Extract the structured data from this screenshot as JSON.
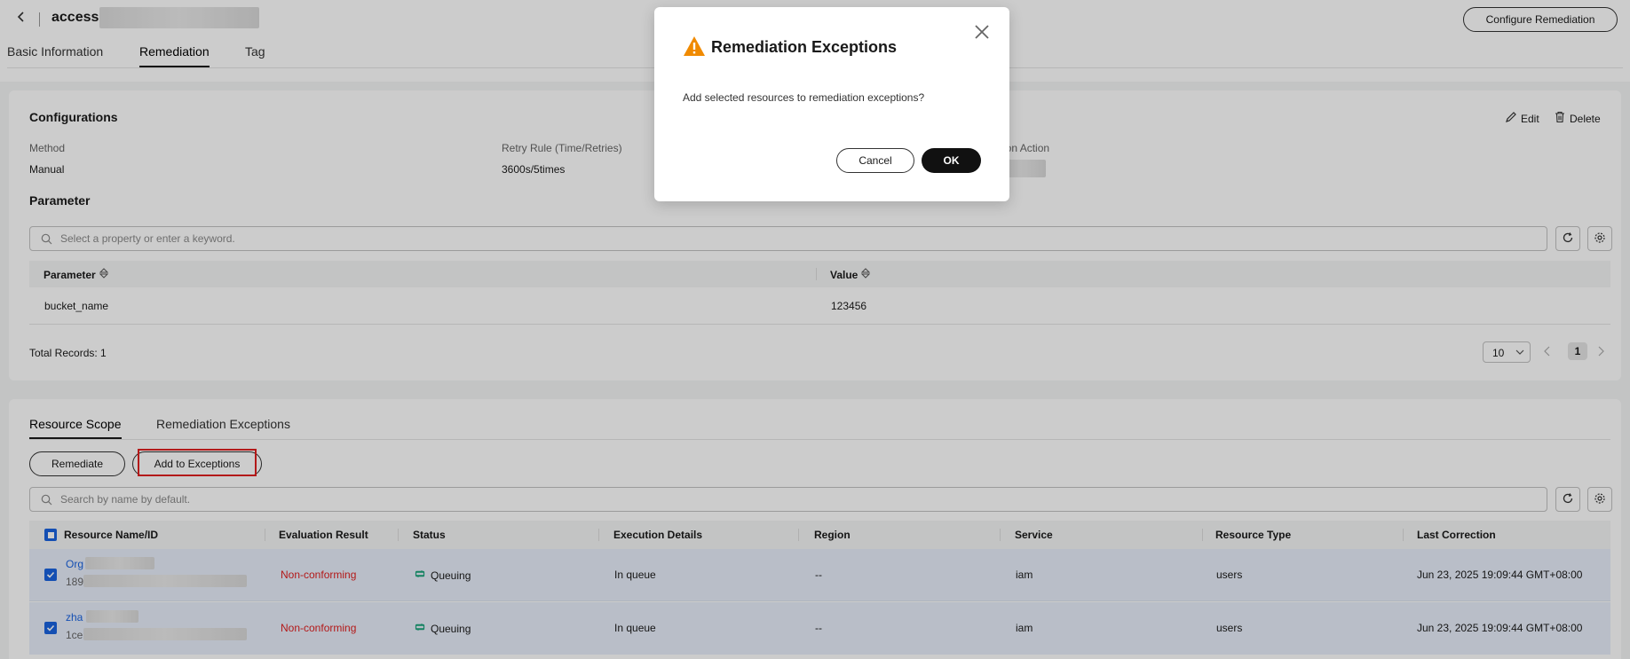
{
  "header": {
    "title": "access",
    "configure_label": "Configure Remediation",
    "tabs": [
      {
        "label": "Basic Information",
        "active": false
      },
      {
        "label": "Remediation",
        "active": true
      },
      {
        "label": "Tag",
        "active": false
      }
    ]
  },
  "config": {
    "title": "Configurations",
    "edit_label": "Edit",
    "delete_label": "Delete",
    "method_label": "Method",
    "method_value": "Manual",
    "retry_label": "Retry Rule (Time/Retries)",
    "retry_value": "3600s/5times",
    "action_label": "ation Action",
    "parameter_title": "Parameter",
    "search_placeholder": "Select a property or enter a keyword.",
    "table": {
      "columns": [
        "Parameter",
        "Value"
      ],
      "rows": [
        {
          "parameter": "bucket_name",
          "value": "123456"
        }
      ]
    },
    "total_records": "Total Records: 1",
    "page_size": "10",
    "current_page": "1"
  },
  "resource": {
    "tabs": [
      {
        "label": "Resource Scope",
        "active": true
      },
      {
        "label": "Remediation Exceptions",
        "active": false
      }
    ],
    "remediate_label": "Remediate",
    "add_exceptions_label": "Add to Exceptions",
    "search_placeholder": "Search by name by default.",
    "columns": [
      "Resource Name/ID",
      "Evaluation Result",
      "Status",
      "Execution Details",
      "Region",
      "Service",
      "Resource Type",
      "Last Correction"
    ],
    "rows": [
      {
        "name": "Org",
        "id": "189",
        "eval": "Non-conforming",
        "status": "Queuing",
        "details": "In queue",
        "region": "--",
        "service": "iam",
        "type": "users",
        "last": "Jun 23, 2025 19:09:44 GMT+08:00"
      },
      {
        "name": "zha",
        "id": "1ce",
        "eval": "Non-conforming",
        "status": "Queuing",
        "details": "In queue",
        "region": "--",
        "service": "iam",
        "type": "users",
        "last": "Jun 23, 2025 19:09:44 GMT+08:00"
      }
    ]
  },
  "dialog": {
    "title": "Remediation Exceptions",
    "message": "Add selected resources to remediation exceptions?",
    "cancel_label": "Cancel",
    "ok_label": "OK"
  },
  "colors": {
    "accent": "#1a63e0",
    "danger": "#e02020",
    "warning": "#f08a00",
    "queuing": "#1aa37a"
  },
  "icons": [
    "back-arrow-icon",
    "edit-icon",
    "trash-icon",
    "search-icon",
    "refresh-icon",
    "gear-icon",
    "sort-icon",
    "chevron-down-icon",
    "chevron-left-icon",
    "chevron-right-icon",
    "checkbox-icon",
    "queuing-status-icon",
    "warning-icon",
    "close-icon"
  ]
}
